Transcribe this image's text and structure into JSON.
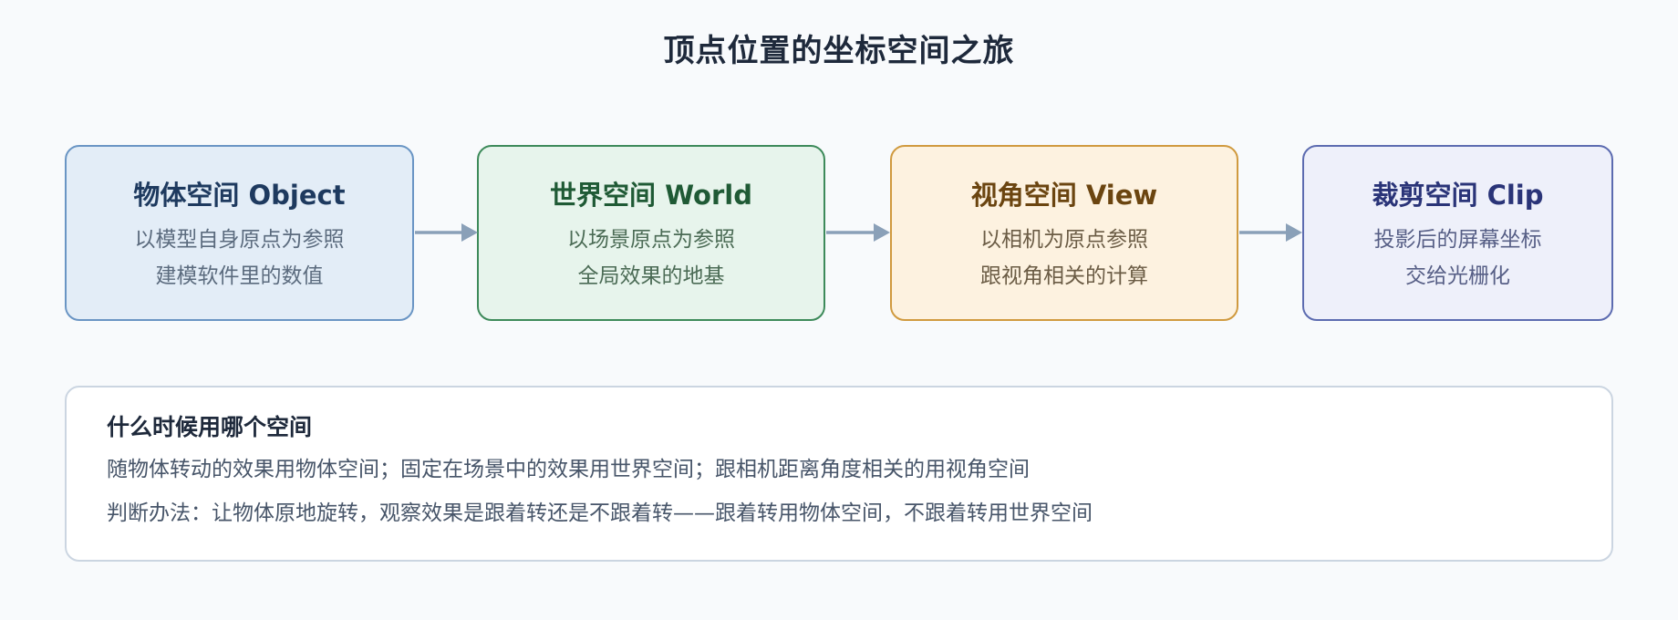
{
  "title": "顶点位置的坐标空间之旅",
  "nodes": [
    {
      "title": "物体空间 Object",
      "lines": [
        "以模型自身原点为参照",
        "建模软件里的数值"
      ]
    },
    {
      "title": "世界空间 World",
      "lines": [
        "以场景原点为参照",
        "全局效果的地基"
      ]
    },
    {
      "title": "视角空间 View",
      "lines": [
        "以相机为原点参照",
        "跟视角相关的计算"
      ]
    },
    {
      "title": "裁剪空间 Clip",
      "lines": [
        "投影后的屏幕坐标",
        "交给光栅化"
      ]
    }
  ],
  "note": {
    "title": "什么时候用哪个空间",
    "lines": [
      "随物体转动的效果用物体空间；固定在场景中的效果用世界空间；跟相机距离角度相关的用视角空间",
      "判断办法：让物体原地旋转，观察效果是跟着转还是不跟着转——跟着转用物体空间，不跟着转用世界空间"
    ]
  },
  "colors": {
    "background": "#f8fafc",
    "arrow": "#8aa0b8",
    "object": "#6a95c4",
    "world": "#3d8a5a",
    "view": "#d09a3f",
    "clip": "#5c6bb0"
  }
}
